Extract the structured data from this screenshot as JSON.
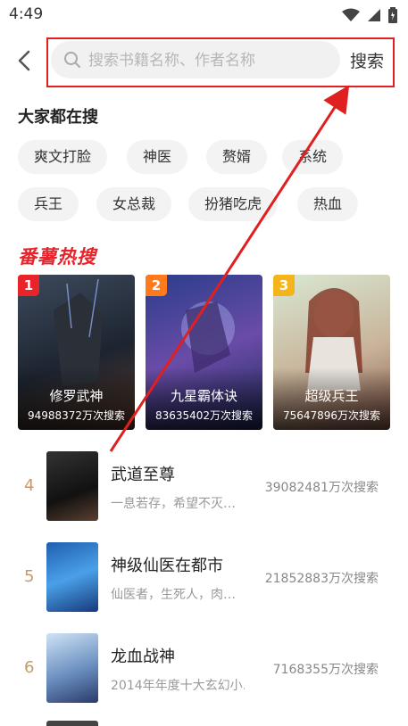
{
  "status": {
    "time": "4:49"
  },
  "search": {
    "placeholder": "搜索书籍名称、作者名称",
    "button": "搜索"
  },
  "hot_section": {
    "title": "大家都在搜"
  },
  "tags": [
    "爽文打脸",
    "神医",
    "赘婿",
    "系统",
    "兵王",
    "女总裁",
    "扮猪吃虎",
    "热血"
  ],
  "hot_logo": "番薯热搜",
  "top3": [
    {
      "rank": "1",
      "title": "修罗武神",
      "count": "94988372万次搜索",
      "badge_color": "#e8232a"
    },
    {
      "rank": "2",
      "title": "九星霸体诀",
      "count": "83635402万次搜索",
      "badge_color": "#ff7a1a"
    },
    {
      "rank": "3",
      "title": "超级兵王",
      "count": "75647896万次搜索",
      "badge_color": "#f5b41a"
    }
  ],
  "rank_list": [
    {
      "rank": "4",
      "title": "武道至尊",
      "desc": "一息若存，希望不灭…",
      "count": "39082481万次搜索"
    },
    {
      "rank": "5",
      "title": "神级仙医在都市",
      "desc": "仙医者，生死人，肉…",
      "count": "21852883万次搜索"
    },
    {
      "rank": "6",
      "title": "龙血战神",
      "desc": "2014年年度十大玄幻小…",
      "count": "7168355万次搜索"
    }
  ],
  "colors": {
    "accent_red": "#e02020",
    "rank_number": "#c49a6c"
  }
}
